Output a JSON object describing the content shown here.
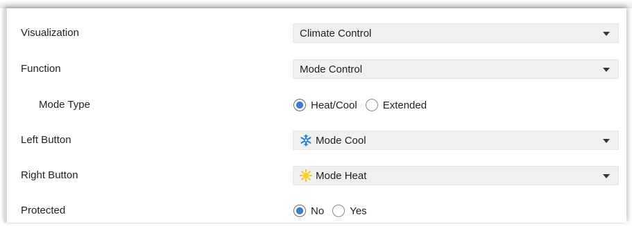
{
  "rows": {
    "visualization": {
      "label": "Visualization",
      "value": "Climate Control"
    },
    "function": {
      "label": "Function",
      "value": "Mode Control"
    },
    "mode_type": {
      "label": "Mode Type",
      "options": [
        "Heat/Cool",
        "Extended"
      ],
      "selected": "Heat/Cool"
    },
    "left_button": {
      "label": "Left Button",
      "value": "Mode Cool",
      "icon": "snowflake-icon",
      "icon_color": "#1f7fd6"
    },
    "right_button": {
      "label": "Right Button",
      "value": "Mode Heat",
      "icon": "sun-icon",
      "icon_color": "#f5b800"
    },
    "protected": {
      "label": "Protected",
      "options": [
        "No",
        "Yes"
      ],
      "selected": "No"
    }
  },
  "colors": {
    "radio_selected": "#3b7fd0",
    "select_bg": "#f0f0f0"
  }
}
